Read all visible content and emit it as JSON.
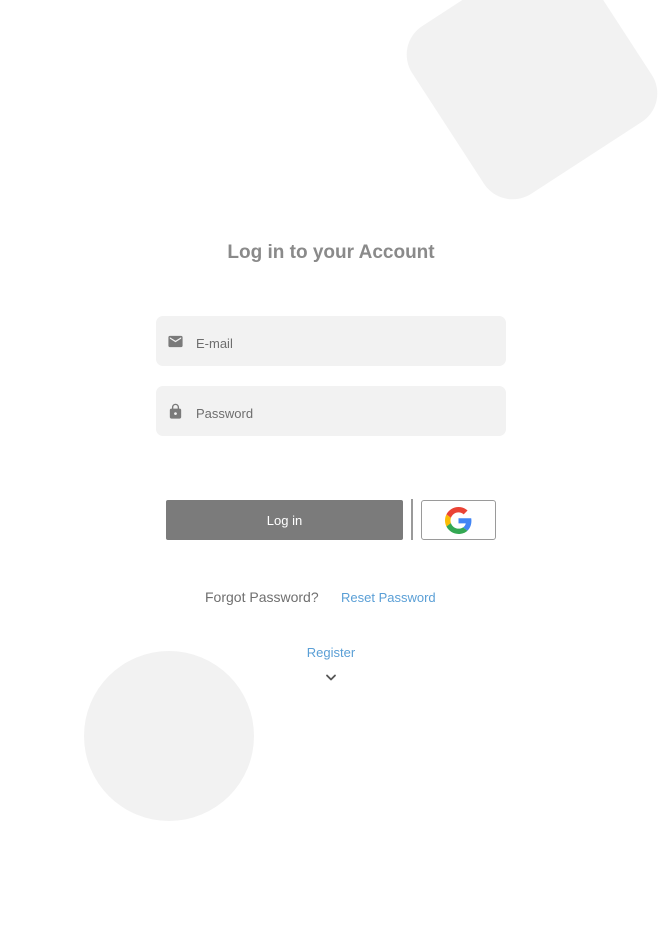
{
  "login": {
    "title": "Log in to your Account",
    "email": {
      "placeholder": "E-mail",
      "value": "",
      "icon": "mail-icon"
    },
    "password": {
      "placeholder": "Password",
      "value": "",
      "icon": "lock-icon"
    },
    "login_button_label": "Log in",
    "google_icon": "google-g-icon",
    "forgot_password_label": "Forgot Password?",
    "reset_password_label": "Reset Password",
    "register_label": "Register",
    "register_icon": "chevron-down-icon"
  },
  "colors": {
    "background": "#ffffff",
    "decoration": "#f2f2f2",
    "field_background": "#f2f2f2",
    "title_text": "#8a8a8a",
    "button_background": "#7b7b7b",
    "link": "#5a9fd6",
    "google_blue": "#4285F4",
    "google_red": "#EA4335",
    "google_yellow": "#FBBC05",
    "google_green": "#34A853"
  }
}
